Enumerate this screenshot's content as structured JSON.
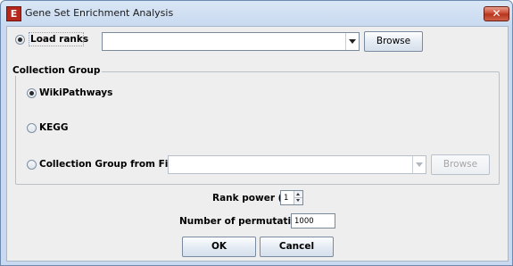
{
  "window": {
    "app_icon_letter": "E",
    "title": "Gene Set Enrichment Analysis",
    "close_symbol": "✕"
  },
  "load_ranks": {
    "label": "Load ranks",
    "selected": true,
    "combo_value": "",
    "browse_label": "Browse"
  },
  "collection_group": {
    "title": "Collection Group",
    "options": [
      {
        "label": "WikiPathways",
        "selected": true
      },
      {
        "label": "KEGG",
        "selected": false
      },
      {
        "label": "Collection Group from File:",
        "selected": false
      }
    ],
    "file_combo_value": "",
    "file_browse_label": "Browse"
  },
  "rank_power": {
    "label": "Rank power (p)",
    "value": "1"
  },
  "permutations": {
    "label": "Number of permutations:",
    "value": "1000"
  },
  "actions": {
    "ok_label": "OK",
    "cancel_label": "Cancel"
  },
  "colors": {
    "title_bar": "#d9e6f5",
    "client_background": "#eeeeee",
    "close_button": "#c7432a"
  }
}
